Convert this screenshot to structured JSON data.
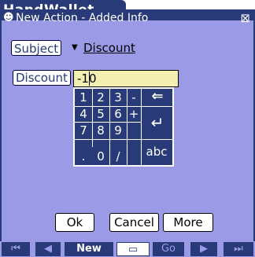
{
  "app": {
    "name": "HandWallet"
  },
  "dialog": {
    "title": "New Action - Added Info",
    "close_icon": "close-x-icon",
    "title_icon": "info-round-icon"
  },
  "subject": {
    "label": "Subject",
    "value": "Discount"
  },
  "discount": {
    "label": "Discount",
    "value": "-10"
  },
  "keypad": {
    "keys": [
      "1",
      "2",
      "3",
      "-",
      "4",
      "5",
      "6",
      "+",
      "7",
      "8",
      "9",
      ".",
      "0",
      "/"
    ],
    "abc": "abc"
  },
  "buttons": {
    "ok": "Ok",
    "cancel": "Cancel",
    "more": "More"
  },
  "taskbar": {
    "new": "New",
    "go": "Go"
  },
  "colors": {
    "navy": "#283a78",
    "lavender": "#9a9ae6",
    "field": "#f3efb0",
    "white": "#ffffff"
  }
}
